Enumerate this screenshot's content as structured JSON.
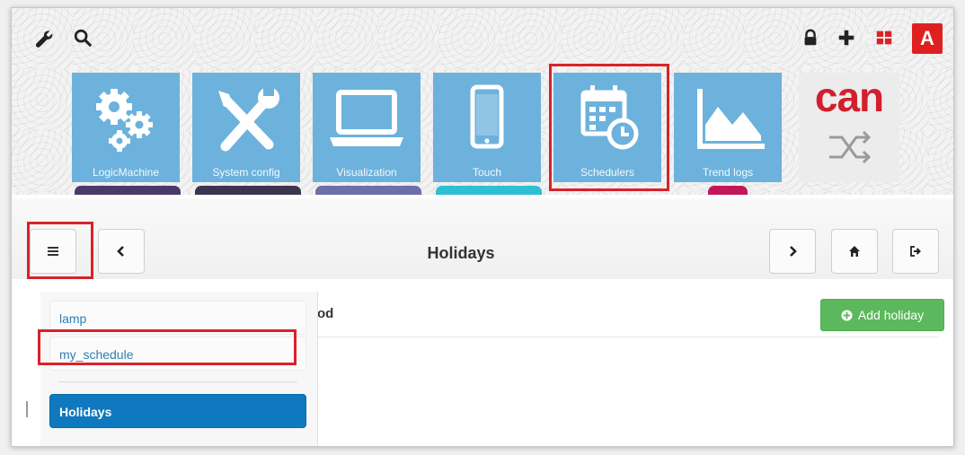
{
  "topbar": {
    "left_icons": [
      "wrench-icon",
      "search-icon"
    ],
    "right_icons": [
      "lock-icon",
      "plus-icon",
      "apps-grid-icon"
    ],
    "avatar_letter": "A"
  },
  "apps": [
    {
      "label": "LogicMachine",
      "icon": "gears-icon"
    },
    {
      "label": "System config",
      "icon": "tools-icon"
    },
    {
      "label": "Visualization",
      "icon": "laptop-icon"
    },
    {
      "label": "Touch",
      "icon": "smartphone-icon"
    },
    {
      "label": "Schedulers",
      "icon": "calendar-clock-icon"
    },
    {
      "label": "Trend logs",
      "icon": "area-chart-icon"
    }
  ],
  "can_app": {
    "text": "can",
    "icon": "can-bus-icon"
  },
  "toolbar": {
    "title": "Holidays",
    "left_buttons": [
      "menu-icon",
      "chevron-left-icon"
    ],
    "right_buttons": [
      "chevron-right-icon",
      "home-icon",
      "logout-icon"
    ]
  },
  "content": {
    "column_header": "riod",
    "add_button_label": "Add holiday",
    "add_button_icon": "plus-circle-icon"
  },
  "dropdown": {
    "items": [
      "lamp",
      "my_schedule"
    ],
    "active_item": "Holidays"
  },
  "colors": {
    "tile": "#6cb2dc",
    "highlight": "#d8232a",
    "primary": "#0e79bf",
    "success": "#5cb85c",
    "avatar": "#e02020",
    "can_red": "#d21f2e"
  }
}
